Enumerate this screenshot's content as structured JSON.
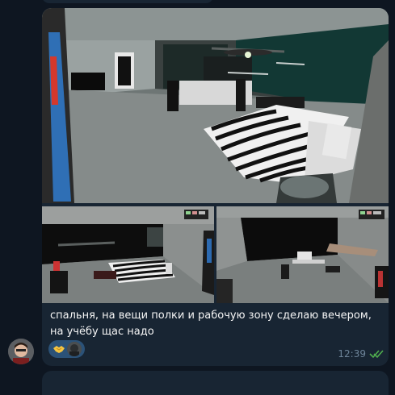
{
  "message": {
    "caption": "спальня, на вещи полки и рабочую зону сделаю вечером, на учёбу щас надо",
    "time": "12:39",
    "status_icon": "double-check-icon",
    "photos": [
      {
        "name": "bedroom-photo-main"
      },
      {
        "name": "bedroom-photo-bed"
      },
      {
        "name": "bedroom-photo-workspace"
      }
    ],
    "reactions": [
      {
        "emoji_icon": "handshake-emoji",
        "reactor": "user-avatar"
      }
    ]
  },
  "colors": {
    "background": "#0e1621",
    "bubble": "#182533",
    "text": "#f5f5f5",
    "meta": "#6d8499",
    "reaction_bg": "#2b5278",
    "read_check": "#4fae4e"
  }
}
